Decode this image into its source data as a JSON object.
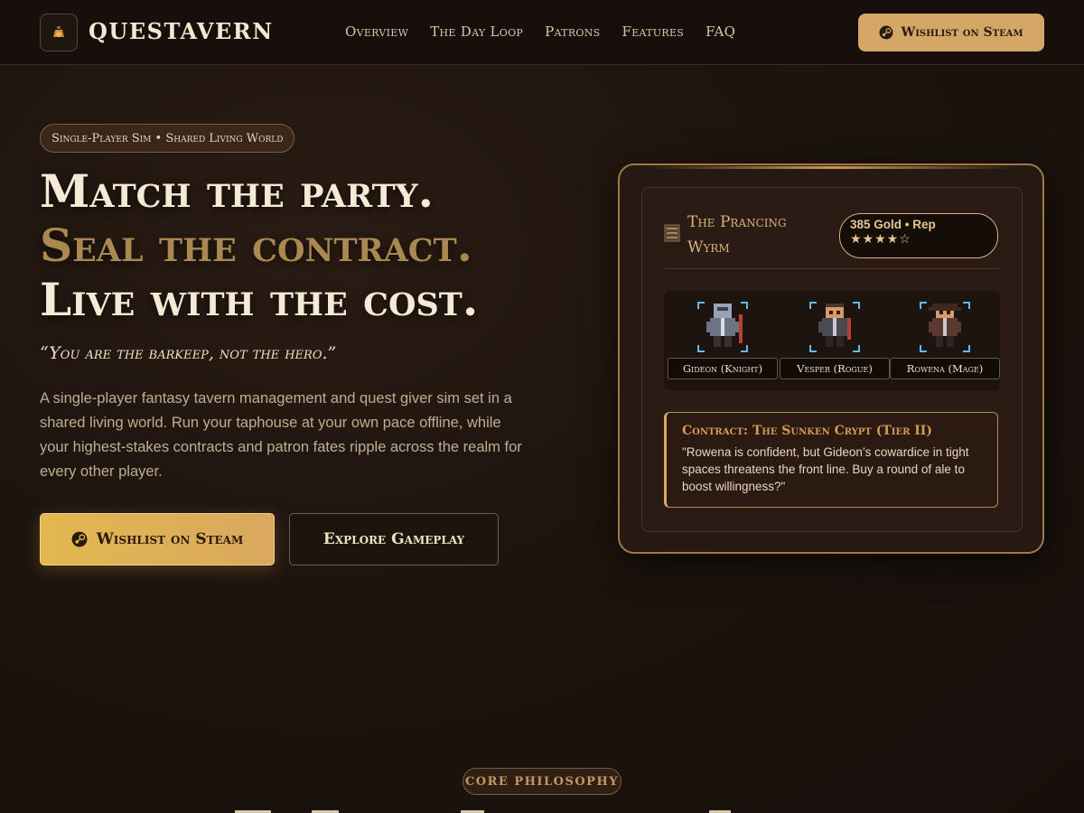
{
  "nav": {
    "brand": "QUESTAVERN",
    "links": [
      "Overview",
      "The Day Loop",
      "Patrons",
      "Features",
      "FAQ"
    ],
    "cta_label": "Wishlist on Steam"
  },
  "hero": {
    "pill": "Single-Player Sim • Shared Living World",
    "headline": [
      "Match the party.",
      "Seal the contract.",
      "Live with the cost."
    ],
    "quote": "“You are the barkeep, not the hero.”",
    "description": "A single-player fantasy tavern management and quest giver sim set in a shared living world. Run your taphouse at your own pace offline, while your highest-stakes contracts and patron fates ripple across the realm for every other player.",
    "primary_button": "Wishlist on Steam",
    "secondary_button": "Explore Gameplay"
  },
  "card": {
    "tavern_name": "The Prancing Wyrm",
    "rep_text": "385 Gold • Rep",
    "rep_stars": "★★★★☆",
    "party": [
      {
        "label": "Gideon (Knight)"
      },
      {
        "label": "Vesper (Rogue)"
      },
      {
        "label": "Rowena (Mage)"
      }
    ],
    "contract": {
      "title": "Contract: The Sunken Crypt (Tier II)",
      "text": "\"Rowena is confident, but Gideon’s cowardice in tight spaces threatens the front line. Buy a round of ale to boost willingness?\""
    }
  },
  "section": {
    "pill": "CORE PHILOSOPHY"
  },
  "icons": {
    "logo": "potion-lantern-icon",
    "steam": "steam-icon",
    "tavern": "tavern-sign-icon"
  },
  "colors": {
    "accent_gold": "#d4a766",
    "background": "#1d140e",
    "sprite_frame": "#6ab6e8"
  }
}
